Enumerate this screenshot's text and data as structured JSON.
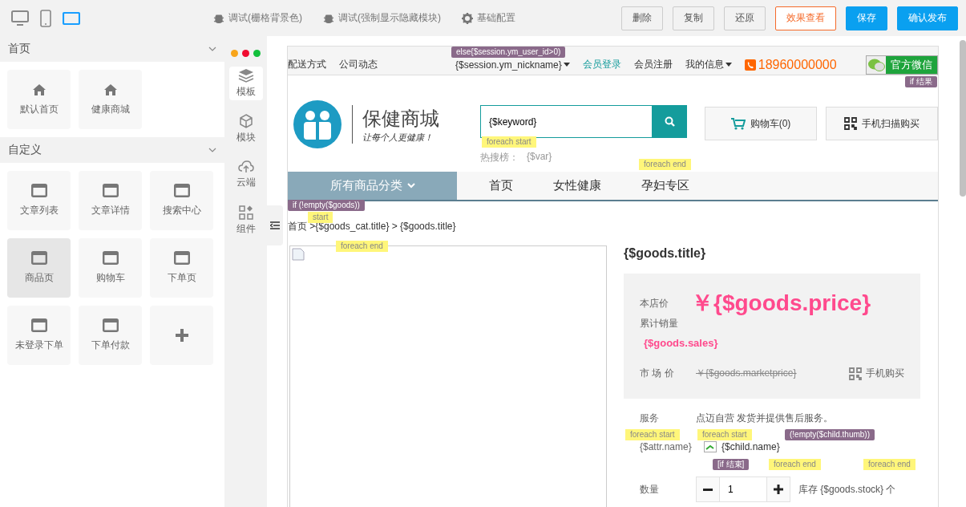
{
  "toolbar": {
    "devices": [
      {
        "kind": "desktop",
        "selected": false
      },
      {
        "kind": "mobile",
        "selected": false
      },
      {
        "kind": "tablet",
        "selected": true
      }
    ],
    "debug": [
      "调试(栅格背景色)",
      "调试(强制显示隐藏模块)"
    ],
    "config": "基础配置",
    "actions": [
      {
        "label": "删除",
        "kind": "plain"
      },
      {
        "label": "复制",
        "kind": "plain"
      },
      {
        "label": "还原",
        "kind": "plain"
      },
      {
        "label": "效果查看",
        "kind": "outline"
      },
      {
        "label": "保存",
        "kind": "primary"
      },
      {
        "label": "确认发布",
        "kind": "primary"
      }
    ]
  },
  "sidebar": {
    "sections": [
      {
        "title": "首页",
        "expanded": true,
        "items": [
          {
            "kind": "home",
            "label": "默认首页",
            "selected": false
          },
          {
            "kind": "home",
            "label": "健康商城",
            "selected": false
          }
        ]
      },
      {
        "title": "自定义",
        "expanded": true,
        "items": [
          {
            "kind": "page",
            "label": "文章列表",
            "selected": false
          },
          {
            "kind": "page",
            "label": "文章详情",
            "selected": false
          },
          {
            "kind": "page",
            "label": "搜索中心",
            "selected": false
          },
          {
            "kind": "page",
            "label": "商品页",
            "selected": true
          },
          {
            "kind": "page",
            "label": "购物车",
            "selected": false
          },
          {
            "kind": "page",
            "label": "下单页",
            "selected": false
          },
          {
            "kind": "page",
            "label": "未登录下单",
            "selected": false
          },
          {
            "kind": "page",
            "label": "下单付款",
            "selected": false
          },
          {
            "kind": "add",
            "selected": false
          }
        ]
      }
    ]
  },
  "rail": {
    "items": [
      {
        "kind": "layers",
        "label": "模板",
        "selected": true
      },
      {
        "kind": "cube",
        "label": "模块",
        "selected": false
      },
      {
        "kind": "cloud",
        "label": "云端",
        "selected": false
      },
      {
        "kind": "widgets",
        "label": "组件",
        "selected": false
      }
    ]
  },
  "preview": {
    "topnav": {
      "links": [
        "配送方式",
        "公司动态"
      ],
      "nickname": "{$session.ym_nickname}",
      "login": "会员登录",
      "register": "会员注册",
      "myinfo": "我的信息",
      "phone": "18960000000",
      "wechat": "官方微信"
    },
    "header": {
      "brand": "保健商城",
      "slogan": "让每个人更健康！",
      "search_value": "{$keyword}",
      "hot_label": "热搜榜：",
      "hot_item": "{$var}",
      "cart": "购物车(0)",
      "scan": "手机扫描购买"
    },
    "nav": {
      "category": "所有商品分类",
      "links": [
        {
          "label": "首页",
          "selected": false
        },
        {
          "label": "女性健康",
          "selected": false
        },
        {
          "label": "孕妇专区",
          "selected": false
        }
      ]
    },
    "breadcrumb": "首页 >{$goods_cat.title} > {$goods.title}",
    "product": {
      "title": "{$goods.title}",
      "price_label": "本店价",
      "price": "￥{$goods.price}",
      "sales_label": "累计销量",
      "sales": "{$goods.sales}",
      "market_label": "市 场 价",
      "market_price": "￥{$goods.marketprice}",
      "mobile_buy": "手机购买",
      "service_label": "服务",
      "service": "点迈自营 发货并提供售后服务。",
      "attr_name": "{$attr.name}",
      "child_name": "{$child.name}",
      "qty_label": "数量",
      "qty": "1",
      "stock": "库存 {$goods.stock} 个"
    },
    "tags": [
      {
        "kind": "logic",
        "text": "else{$session.ym_user_id>0)"
      },
      {
        "kind": "logic",
        "text": "if 结果"
      },
      {
        "kind": "loop",
        "text": "foreach start"
      },
      {
        "kind": "loop",
        "text": "foreach end"
      },
      {
        "kind": "logic",
        "text": "if (!empty($goods))"
      },
      {
        "kind": "loop",
        "text": "start"
      },
      {
        "kind": "loop",
        "text": "foreach end"
      },
      {
        "kind": "loop",
        "text": "foreach start"
      },
      {
        "kind": "loop",
        "text": "foreach start"
      },
      {
        "kind": "logic",
        "text": "(!empty($child.thumb))"
      },
      {
        "kind": "logic",
        "text": "[if 结束]"
      },
      {
        "kind": "loop",
        "text": "foreach end"
      },
      {
        "kind": "loop",
        "text": "foreach end"
      }
    ]
  }
}
